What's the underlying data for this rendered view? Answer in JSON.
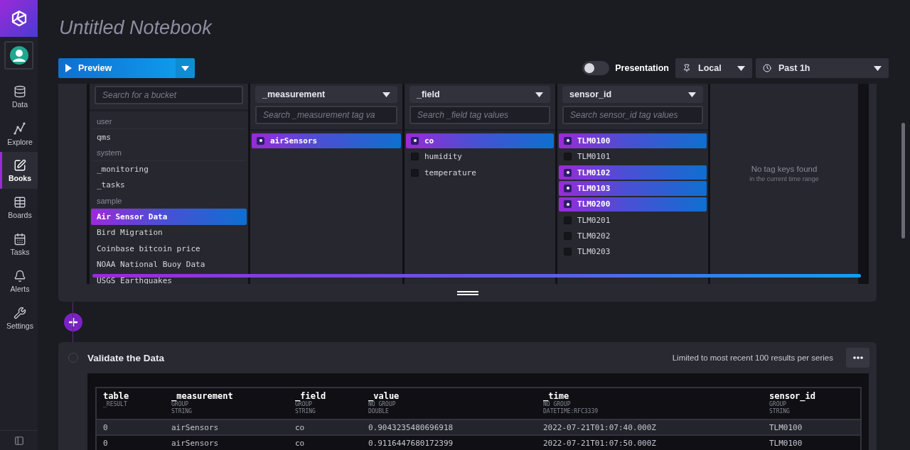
{
  "sidebar": {
    "items": [
      {
        "label": "Data",
        "selected": false
      },
      {
        "label": "Explore",
        "selected": false
      },
      {
        "label": "Books",
        "selected": true
      },
      {
        "label": "Boards",
        "selected": false
      },
      {
        "label": "Tasks",
        "selected": false
      },
      {
        "label": "Alerts",
        "selected": false
      },
      {
        "label": "Settings",
        "selected": false
      }
    ]
  },
  "notebook": {
    "title": "Untitled Notebook"
  },
  "toolbar": {
    "preview_button": "Preview",
    "presentation": {
      "label": "Presentation",
      "on": false
    },
    "timezone": "Local",
    "time_range": "Past 1h"
  },
  "query_builder": {
    "bucket_search": {
      "placeholder": "Search for a bucket"
    },
    "buckets": [
      {
        "kind": "group",
        "label": "user",
        "selected": false
      },
      {
        "kind": "item",
        "label": "qms",
        "selected": false
      },
      {
        "kind": "group",
        "label": "system",
        "selected": false
      },
      {
        "kind": "item",
        "label": "_monitoring",
        "selected": false
      },
      {
        "kind": "item",
        "label": "_tasks",
        "selected": false
      },
      {
        "kind": "group",
        "label": "sample",
        "selected": false
      },
      {
        "kind": "item",
        "label": "Air Sensor Data",
        "selected": true
      },
      {
        "kind": "item",
        "label": "Bird Migration",
        "selected": false
      },
      {
        "kind": "item",
        "label": "Coinbase bitcoin price",
        "selected": false
      },
      {
        "kind": "item",
        "label": "NOAA National Buoy Data",
        "selected": false
      },
      {
        "kind": "item",
        "label": "USGS Earthquakes",
        "selected": false
      }
    ],
    "tag_columns": [
      {
        "key": "_measurement",
        "placeholder": "Search _measurement tag va",
        "values": [
          {
            "label": "airSensors",
            "selected": true
          }
        ]
      },
      {
        "key": "_field",
        "placeholder": "Search _field tag values",
        "values": [
          {
            "label": "co",
            "selected": true
          },
          {
            "label": "humidity",
            "selected": false
          },
          {
            "label": "temperature",
            "selected": false
          }
        ]
      },
      {
        "key": "sensor_id",
        "placeholder": "Search sensor_id tag values",
        "values": [
          {
            "label": "TLM0100",
            "selected": true
          },
          {
            "label": "TLM0101",
            "selected": false
          },
          {
            "label": "TLM0102",
            "selected": true
          },
          {
            "label": "TLM0103",
            "selected": true
          },
          {
            "label": "TLM0200",
            "selected": true
          },
          {
            "label": "TLM0201",
            "selected": false
          },
          {
            "label": "TLM0202",
            "selected": false
          },
          {
            "label": "TLM0203",
            "selected": false
          }
        ]
      }
    ],
    "empty": {
      "title": "No tag keys found",
      "subtitle": "in the current time range"
    }
  },
  "validate": {
    "title": "Validate the Data",
    "note": "Limited to most recent 100 results per series",
    "columns": [
      {
        "name": "table",
        "meta": [
          "_RESULT"
        ]
      },
      {
        "name": "_measurement",
        "meta": [
          "GROUP",
          "STRING"
        ]
      },
      {
        "name": "_field",
        "meta": [
          "GROUP",
          "STRING"
        ]
      },
      {
        "name": "_value",
        "meta": [
          "NO GROUP",
          "DOUBLE"
        ]
      },
      {
        "name": "_time",
        "meta": [
          "NO GROUP",
          "DATETIME:RFC3339"
        ]
      },
      {
        "name": "sensor_id",
        "meta": [
          "GROUP",
          "STRING"
        ]
      }
    ],
    "rows": [
      [
        "0",
        "airSensors",
        "co",
        "0.9043235480696918",
        "2022-07-21T01:07:40.000Z",
        "TLM0100"
      ],
      [
        "0",
        "airSensors",
        "co",
        "0.9116447680172399",
        "2022-07-21T01:07:50.000Z",
        "TLM0100"
      ]
    ]
  }
}
